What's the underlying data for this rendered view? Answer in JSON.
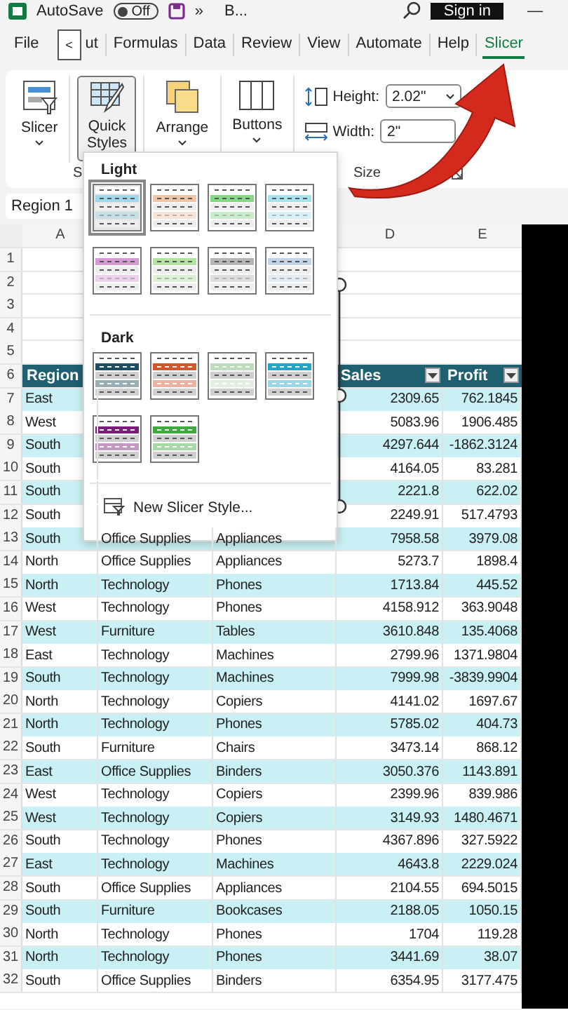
{
  "title_bar": {
    "autosave_label": "AutoSave",
    "autosave": {
      "on": false,
      "text": "Off"
    },
    "overflow": "»",
    "file_name": "B...",
    "sign_in": "Sign in",
    "minimize": "—"
  },
  "tabs": [
    {
      "label": "File",
      "selected": false
    },
    {
      "label": "<",
      "kind": "scroll"
    },
    {
      "label": "ut",
      "selected": false
    },
    {
      "label": "Formulas",
      "selected": false
    },
    {
      "label": "Data",
      "selected": false
    },
    {
      "label": "Review",
      "selected": false
    },
    {
      "label": "View",
      "selected": false
    },
    {
      "label": "Automate",
      "selected": false
    },
    {
      "label": "Help",
      "selected": false
    },
    {
      "label": "Slicer",
      "selected": true
    }
  ],
  "ribbon": {
    "slicer": "Slicer",
    "quick_styles": {
      "label": "Quick Styles",
      "selected": true
    },
    "arrange": "Arrange",
    "buttons": "Buttons",
    "height": {
      "label": "Height:",
      "value": "2.02\""
    },
    "width": {
      "label": "Width:",
      "value": "2\""
    },
    "group_label_1": "S",
    "group_label_size": "Size"
  },
  "name_box": "Region 1",
  "column_headers": [
    "A",
    "D",
    "E"
  ],
  "empty_rows": [
    "1",
    "2",
    "3",
    "4",
    "5"
  ],
  "header_row": {
    "num": "6",
    "cells": [
      {
        "text": "Region"
      },
      {
        "text": "Sales",
        "filter_button": true
      },
      {
        "text": "Profit",
        "filter_button": true
      }
    ]
  },
  "rows": [
    {
      "num": "7",
      "region": "East",
      "sales": "2309.65",
      "profit": "762.1845"
    },
    {
      "num": "8",
      "region": "West",
      "sales": "5083.96",
      "profit": "1906.485"
    },
    {
      "num": "9",
      "region": "South",
      "sales": "4297.644",
      "profit": "-1862.3124"
    },
    {
      "num": "10",
      "region": "South",
      "sales": "4164.05",
      "profit": "83.281"
    },
    {
      "num": "11",
      "region": "South",
      "sales": "2221.8",
      "profit": "622.02"
    },
    {
      "num": "12",
      "region": "South",
      "sales": "2249.91",
      "profit": "517.4793"
    },
    {
      "num": "13",
      "region": "South",
      "category": "Office Supplies",
      "sub_category": "Appliances",
      "sales": "7958.58",
      "profit": "3979.08"
    },
    {
      "num": "14",
      "region": "North",
      "category": "Office Supplies",
      "sub_category": "Appliances",
      "sales": "5273.7",
      "profit": "1898.4"
    },
    {
      "num": "15",
      "region": "North",
      "category": "Technology",
      "sub_category": "Phones",
      "sales": "1713.84",
      "profit": "445.52"
    },
    {
      "num": "16",
      "region": "West",
      "category": "Technology",
      "sub_category": "Phones",
      "sales": "4158.912",
      "profit": "363.9048"
    },
    {
      "num": "17",
      "region": "West",
      "category": "Furniture",
      "sub_category": "Tables",
      "sales": "3610.848",
      "profit": "135.4068"
    },
    {
      "num": "18",
      "region": "East",
      "category": "Technology",
      "sub_category": "Machines",
      "sales": "2799.96",
      "profit": "1371.9804"
    },
    {
      "num": "19",
      "region": "South",
      "category": "Technology",
      "sub_category": "Machines",
      "sales": "7999.98",
      "profit": "-3839.9904"
    },
    {
      "num": "20",
      "region": "North",
      "category": "Technology",
      "sub_category": "Copiers",
      "sales": "4141.02",
      "profit": "1697.67"
    },
    {
      "num": "21",
      "region": "North",
      "category": "Technology",
      "sub_category": "Phones",
      "sales": "5785.02",
      "profit": "404.73"
    },
    {
      "num": "22",
      "region": "South",
      "category": "Furniture",
      "sub_category": "Chairs",
      "sales": "3473.14",
      "profit": "868.12"
    },
    {
      "num": "23",
      "region": "East",
      "category": "Office Supplies",
      "sub_category": "Binders",
      "sales": "3050.376",
      "profit": "1143.891"
    },
    {
      "num": "24",
      "region": "West",
      "category": "Technology",
      "sub_category": "Copiers",
      "sales": "2399.96",
      "profit": "839.986"
    },
    {
      "num": "25",
      "region": "West",
      "category": "Technology",
      "sub_category": "Copiers",
      "sales": "3149.93",
      "profit": "1480.4671"
    },
    {
      "num": "26",
      "region": "South",
      "category": "Technology",
      "sub_category": "Phones",
      "sales": "4367.896",
      "profit": "327.5922"
    },
    {
      "num": "27",
      "region": "East",
      "category": "Technology",
      "sub_category": "Machines",
      "sales": "4643.8",
      "profit": "2229.024"
    },
    {
      "num": "28",
      "region": "South",
      "category": "Office Supplies",
      "sub_category": "Appliances",
      "sales": "2104.55",
      "profit": "694.5015"
    },
    {
      "num": "29",
      "region": "South",
      "category": "Furniture",
      "sub_category": "Bookcases",
      "sales": "2188.05",
      "profit": "1050.15"
    },
    {
      "num": "30",
      "region": "North",
      "category": "Technology",
      "sub_category": "Phones",
      "sales": "1704",
      "profit": "119.28"
    },
    {
      "num": "31",
      "region": "North",
      "category": "Technology",
      "sub_category": "Phones",
      "sales": "3441.69",
      "profit": "38.07"
    },
    {
      "num": "32",
      "region": "South",
      "category": "Office Supplies",
      "sub_category": "Binders",
      "sales": "6354.95",
      "profit": "3177.475"
    }
  ],
  "gallery": {
    "light_title": "Light",
    "light": [
      {
        "color": "#9fd8ea",
        "selected": true
      },
      {
        "color": "#f0c6a8",
        "selected": false
      },
      {
        "color": "#86d886",
        "selected": false
      },
      {
        "color": "#a6e3ec",
        "selected": false
      },
      {
        "color": "#d49bd3",
        "selected": false
      },
      {
        "color": "#b3e2a2",
        "selected": false
      },
      {
        "color": "#b5b5b5",
        "selected": false
      },
      {
        "color": "#c2d3e6",
        "selected": false
      }
    ],
    "dark_title": "Dark",
    "dark": [
      {
        "color": "#1d4f60",
        "selected": false
      },
      {
        "color": "#d6562c",
        "selected": false
      },
      {
        "color": "#bcdcbc",
        "selected": false
      },
      {
        "color": "#1fa6c9",
        "selected": false
      },
      {
        "color": "#7b1c7b",
        "selected": false
      },
      {
        "color": "#3eaa3e",
        "selected": false
      }
    ],
    "new_style": "New Slicer Style..."
  }
}
